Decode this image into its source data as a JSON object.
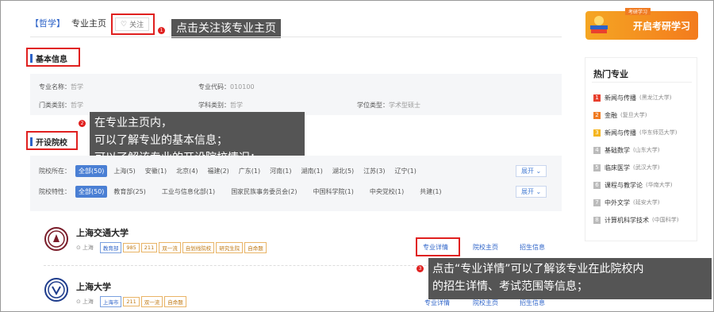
{
  "header": {
    "category_tag": "【哲学】",
    "page_title": "专业主页",
    "follow_label": "关注"
  },
  "callouts": {
    "follow": "点击关注该专业主页",
    "overview": [
      "在专业主页内，",
      "可以了解专业的基本信息；",
      "可以了解该专业的开设院校情况；"
    ],
    "details": [
      "点击“专业详情”可以了解该专业在此院校内",
      "的招生详情、考试范围等信息；"
    ]
  },
  "basic_info": {
    "heading": "基本信息",
    "fields": [
      {
        "label": "专业名称：",
        "value": "哲学"
      },
      {
        "label": "专业代码：",
        "value": "010100"
      },
      {
        "label": "门类类别：",
        "value": "哲学"
      },
      {
        "label": "学科类别：",
        "value": "哲学"
      },
      {
        "label": "学位类型：",
        "value": "学术型硕士"
      }
    ]
  },
  "schools": {
    "heading": "开设院校",
    "region_label": "院校所在：",
    "region_chips": [
      "全部(50)",
      "上海(5)",
      "安徽(1)",
      "北京(4)",
      "福建(2)",
      "广东(1)",
      "河南(1)",
      "湖南(1)",
      "湖北(5)",
      "江苏(3)",
      "辽宁(1)"
    ],
    "type_label": "院校特性：",
    "type_chips": [
      "全部(50)",
      "教育部(25)",
      "工业与信息化部(1)",
      "国家民族事务委员会(2)",
      "中国科学院(1)",
      "中央党校(1)",
      "共建(1)"
    ],
    "more_label": "展开"
  },
  "universities": [
    {
      "name": "上海交通大学",
      "location": "上海",
      "badges": [
        "教育部",
        "985",
        "211",
        "双一流",
        "自划线院校",
        "研究生院",
        "自命题"
      ],
      "links": [
        "专业详情",
        "院校主页",
        "招生信息"
      ]
    },
    {
      "name": "上海大学",
      "location": "上海",
      "badges": [
        "上海市",
        "211",
        "双一流",
        "自命题"
      ],
      "links": [
        "专业详情",
        "院校主页",
        "招生信息"
      ]
    }
  ],
  "sidebar": {
    "banner_label": "开启考研学习",
    "banner_tag": "考研学习",
    "hot_title": "热门专业",
    "hot_items": [
      {
        "num": "1",
        "name": "新闻与传播",
        "school": "(黑龙江大学)",
        "color": "#e8412f"
      },
      {
        "num": "2",
        "name": "金融",
        "school": "(复旦大学)",
        "color": "#f07b22"
      },
      {
        "num": "3",
        "name": "新闻与传播",
        "school": "(华东师范大学)",
        "color": "#f5b51e"
      },
      {
        "num": "4",
        "name": "基础数学",
        "school": "(山东大学)",
        "color": "#bbbbbb"
      },
      {
        "num": "5",
        "name": "临床医学",
        "school": "(武汉大学)",
        "color": "#bbbbbb"
      },
      {
        "num": "6",
        "name": "课程与教学论",
        "school": "(华南大学)",
        "color": "#bbbbbb"
      },
      {
        "num": "7",
        "name": "中外文学",
        "school": "(延安大学)",
        "color": "#bbbbbb"
      },
      {
        "num": "8",
        "name": "计算机科学技术",
        "school": "(中国科学)",
        "color": "#bbbbbb"
      }
    ]
  },
  "markers": [
    "1",
    "2",
    "3"
  ]
}
